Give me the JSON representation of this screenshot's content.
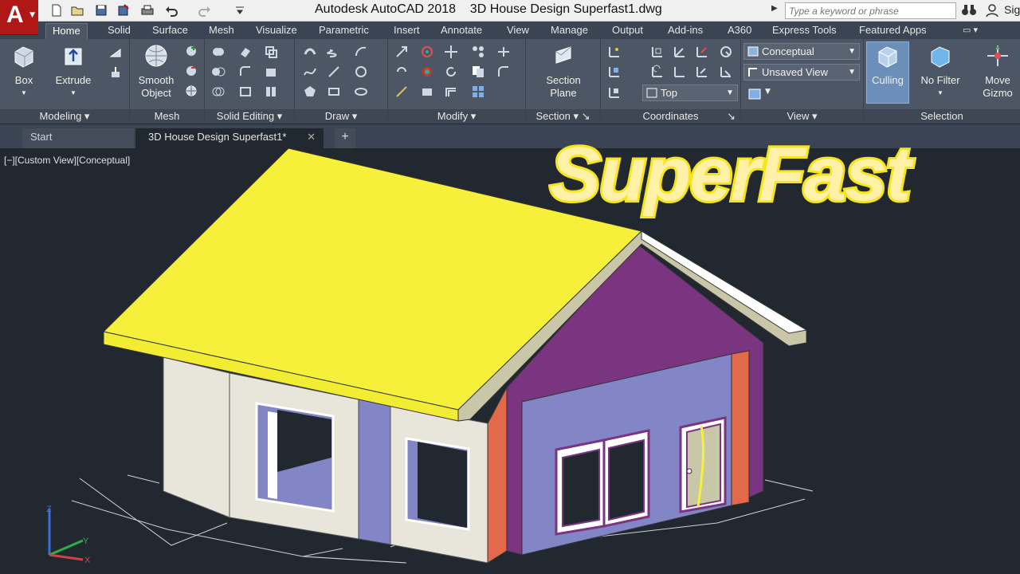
{
  "app": {
    "logo_letter": "A",
    "window_title": "Autodesk AutoCAD 2018    3D House Design Superfast1.dwg",
    "search_placeholder": "Type a keyword or phrase",
    "signin_text": "Sig"
  },
  "ribbon_tabs": [
    "Home",
    "Solid",
    "Surface",
    "Mesh",
    "Visualize",
    "Parametric",
    "Insert",
    "Annotate",
    "View",
    "Manage",
    "Output",
    "Add-ins",
    "A360",
    "Express Tools",
    "Featured Apps"
  ],
  "ribbon": {
    "modeling": {
      "title": "Modeling",
      "box": "Box",
      "extrude": "Extrude"
    },
    "mesh": {
      "title": "Mesh",
      "smooth_object": "Smooth Object"
    },
    "solid_editing": {
      "title": "Solid Editing"
    },
    "draw": {
      "title": "Draw"
    },
    "modify": {
      "title": "Modify"
    },
    "section": {
      "title": "Section",
      "section_plane": "Section Plane"
    },
    "coordinates": {
      "title": "Coordinates",
      "view_dropdown": "Top"
    },
    "view": {
      "title": "View",
      "visual_style": "Conceptual",
      "named_view": "Unsaved View"
    },
    "selection": {
      "title": "Selection",
      "culling": "Culling",
      "no_filter": "No Filter",
      "move_gizmo": "Move Gizmo"
    }
  },
  "file_tabs": {
    "start": "Start",
    "drawing": "3D House Design Superfast1*",
    "add": "+"
  },
  "viewport": {
    "label": "[−][Custom View][Conceptual]",
    "overlay_title": "SuperFast"
  },
  "ucs": {
    "z": "Z",
    "y": "Y",
    "x": "X"
  },
  "colors": {
    "roof": "#f7f03a",
    "gable": "#7a3480",
    "wall_blue": "#8285c6",
    "wall_white": "#e8e6da",
    "accent_orange": "#e2694a",
    "canvas": "#212830",
    "overlay_text": "#f7e41e"
  }
}
